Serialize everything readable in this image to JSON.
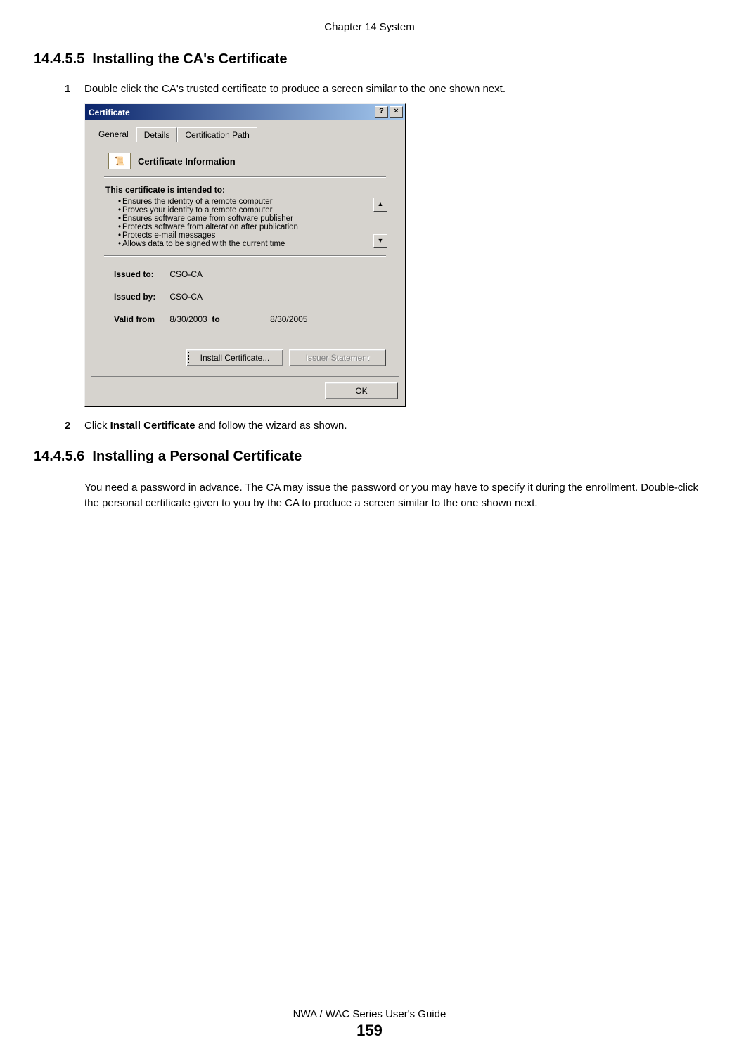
{
  "chapter_header": "Chapter 14 System",
  "section1": {
    "num": "14.4.5.5",
    "title": "Installing the CA's Certificate"
  },
  "step1": {
    "n": "1",
    "text": "Double click the CA's trusted certificate to produce a screen similar to the one shown next."
  },
  "step2": {
    "n": "2",
    "text_pre": "Click ",
    "bold": "Install Certificate",
    "text_post": " and follow the wizard as shown."
  },
  "section2": {
    "num": "14.4.5.6",
    "title": "Installing a Personal Certificate"
  },
  "para2": "You need a password in advance. The CA may issue the password or you may have to specify it during the enrollment. Double-click the personal certificate given to you by the CA to produce a screen similar to the one shown next.",
  "footer": {
    "guide": "NWA / WAC Series User's Guide",
    "page": "159"
  },
  "dialog": {
    "title": "Certificate",
    "help_btn": "?",
    "close_btn": "×",
    "tabs": {
      "general": "General",
      "details": "Details",
      "certpath": "Certification Path"
    },
    "cert_info_heading": "Certificate Information",
    "intended_label": "This certificate is intended to:",
    "purposes": [
      "Ensures the identity of a remote computer",
      "Proves your identity to a remote computer",
      "Ensures software came from software publisher",
      "Protects software from alteration after publication",
      "Protects e-mail messages",
      "Allows data to be signed with the current time"
    ],
    "issued_to": {
      "label": "Issued to:",
      "value": "CSO-CA"
    },
    "issued_by": {
      "label": "Issued by:",
      "value": "CSO-CA"
    },
    "valid": {
      "from_label": "Valid from",
      "from": "8/30/2003",
      "to_label": "to",
      "to": "8/30/2005"
    },
    "install_btn": "Install Certificate...",
    "issuer_btn": "Issuer Statement",
    "ok_btn": "OK",
    "scroll_up": "▲",
    "scroll_down": "▼"
  }
}
